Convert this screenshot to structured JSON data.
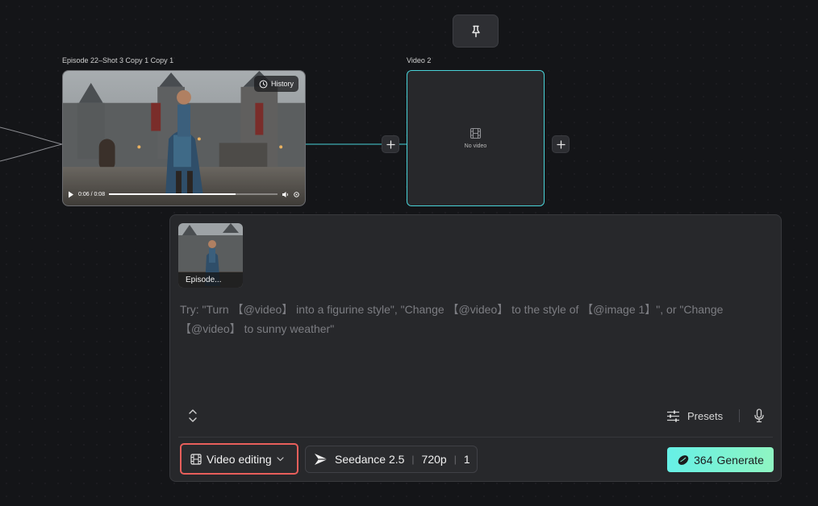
{
  "canvas": {
    "pin_icon": "pin-icon"
  },
  "node1": {
    "title": "Episode 22–Shot 3 Copy 1 Copy 1",
    "history_label": "History",
    "player": {
      "time": "0:06 / 0:08",
      "progress": 0.75
    }
  },
  "node2": {
    "title": "Video 2",
    "empty_text": "No video"
  },
  "prompt": {
    "reference_label": "Episode...",
    "placeholder": "Try: \"Turn 【@video】 into a figurine style\", \"Change 【@video】 to the style of 【@image 1】\", or \"Change 【@video】 to sunny weather\"",
    "presets_label": "Presets",
    "mode": "Video editing",
    "model": "Seedance 2.5",
    "resolution": "720p",
    "count": "1",
    "generate_cost": "364",
    "generate_label": "Generate"
  },
  "colors": {
    "accent_cyan": "#49d3d8",
    "highlight_red": "#e85f5b",
    "generate_start": "#66f0e6",
    "generate_end": "#8ff5c2"
  }
}
